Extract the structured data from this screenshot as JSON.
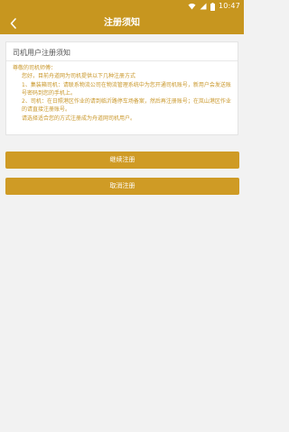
{
  "status_bar": {
    "time": "10:47",
    "icons": [
      "wifi-icon",
      "signal-icon",
      "battery-icon"
    ]
  },
  "header": {
    "title": "注册须知",
    "back_icon": "chevron-left-icon"
  },
  "notice": {
    "title": "司机用户注册须知",
    "greeting": "尊敬的司机师傅：",
    "intro": "您好，目前舟道网为司机提供以下几种注册方式",
    "item1": "1、集装箱司机：请联系物流公司在物流管理系统中为您开通司机账号，新用户会发送账号密码到您的手机上。",
    "item2": "2、司机：在日照港区作业的请到临沂路停车场备案，然后再注册账号；在岚山港区作业的请直接注册账号。",
    "outro": "请选择适合您的方式注册成为舟道网司机用户。"
  },
  "buttons": {
    "continue_label": "继续注册",
    "cancel_label": "取消注册"
  },
  "colors": {
    "brand": "#c7961f",
    "button": "#cf9b25",
    "notice_text": "#c9972a",
    "background": "#f2f2f2"
  }
}
